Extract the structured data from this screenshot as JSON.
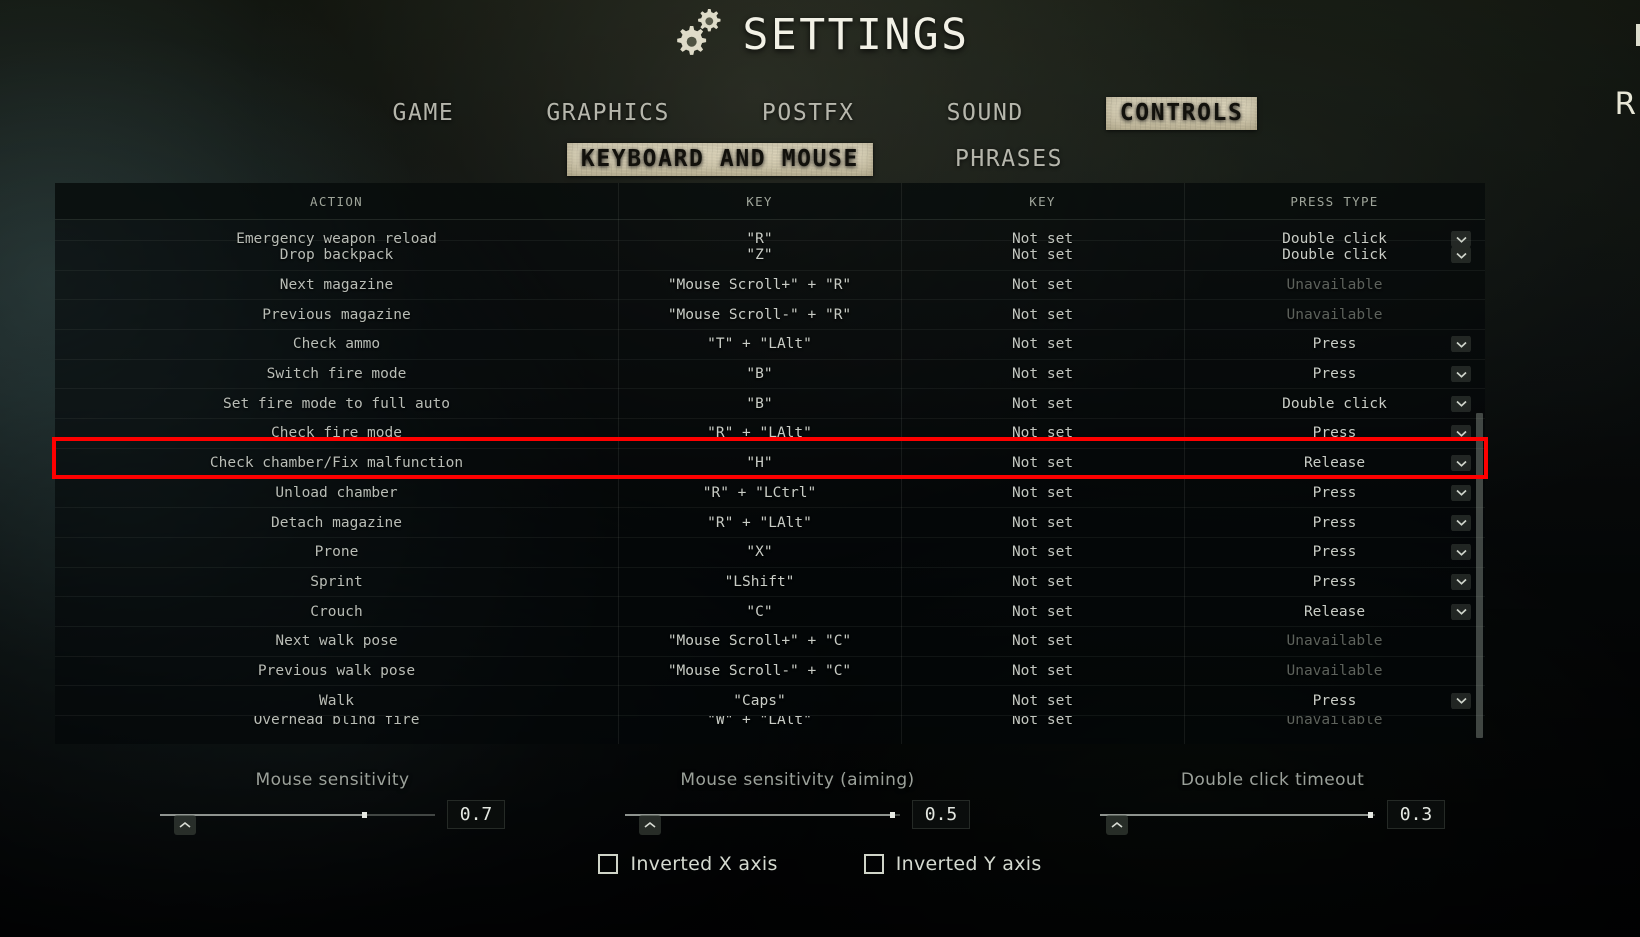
{
  "window": {
    "title": "SETTINGS",
    "gear_icon": "gears-icon",
    "edge_letter": "R"
  },
  "tabs": {
    "primary": [
      {
        "label": "GAME",
        "active": false
      },
      {
        "label": "GRAPHICS",
        "active": false
      },
      {
        "label": "POSTFX",
        "active": false
      },
      {
        "label": "SOUND",
        "active": false
      },
      {
        "label": "CONTROLS",
        "active": true
      }
    ],
    "secondary": [
      {
        "label": "KEYBOARD AND MOUSE",
        "active": true
      },
      {
        "label": "PHRASES",
        "active": false
      }
    ]
  },
  "table": {
    "headers": [
      "ACTION",
      "KEY",
      "KEY",
      "PRESS TYPE"
    ],
    "rows": [
      {
        "action": "Emergency weapon reload",
        "key1": "\"R\"",
        "key2": "Not set",
        "press": "Double click",
        "unavailable": false,
        "clip": "top"
      },
      {
        "action": "Drop backpack",
        "key1": "\"Z\"",
        "key2": "Not set",
        "press": "Double click",
        "unavailable": false
      },
      {
        "action": "Next magazine",
        "key1": "\"Mouse Scroll+\" + \"R\"",
        "key2": "Not set",
        "press": "Unavailable",
        "unavailable": true
      },
      {
        "action": "Previous magazine",
        "key1": "\"Mouse Scroll-\" + \"R\"",
        "key2": "Not set",
        "press": "Unavailable",
        "unavailable": true
      },
      {
        "action": "Check ammo",
        "key1": "\"T\" + \"LAlt\"",
        "key2": "Not set",
        "press": "Press",
        "unavailable": false
      },
      {
        "action": "Switch fire mode",
        "key1": "\"B\"",
        "key2": "Not set",
        "press": "Press",
        "unavailable": false
      },
      {
        "action": "Set fire mode to full auto",
        "key1": "\"B\"",
        "key2": "Not set",
        "press": "Double click",
        "unavailable": false
      },
      {
        "action": "Check fire mode",
        "key1": "\"R\" + \"LAlt\"",
        "key2": "Not set",
        "press": "Press",
        "unavailable": false
      },
      {
        "action": "Check chamber/Fix malfunction",
        "key1": "\"H\"",
        "key2": "Not set",
        "press": "Release",
        "unavailable": false,
        "highlighted": true
      },
      {
        "action": "Unload chamber",
        "key1": "\"R\" + \"LCtrl\"",
        "key2": "Not set",
        "press": "Press",
        "unavailable": false
      },
      {
        "action": "Detach magazine",
        "key1": "\"R\" + \"LAlt\"",
        "key2": "Not set",
        "press": "Press",
        "unavailable": false
      },
      {
        "action": "Prone",
        "key1": "\"X\"",
        "key2": "Not set",
        "press": "Press",
        "unavailable": false
      },
      {
        "action": "Sprint",
        "key1": "\"LShift\"",
        "key2": "Not set",
        "press": "Press",
        "unavailable": false
      },
      {
        "action": "Crouch",
        "key1": "\"C\"",
        "key2": "Not set",
        "press": "Release",
        "unavailable": false
      },
      {
        "action": "Next walk pose",
        "key1": "\"Mouse Scroll+\" + \"C\"",
        "key2": "Not set",
        "press": "Unavailable",
        "unavailable": true
      },
      {
        "action": "Previous walk pose",
        "key1": "\"Mouse Scroll-\" + \"C\"",
        "key2": "Not set",
        "press": "Unavailable",
        "unavailable": true
      },
      {
        "action": "Walk",
        "key1": "\"Caps\"",
        "key2": "Not set",
        "press": "Press",
        "unavailable": false
      },
      {
        "action": "Overhead blind fire",
        "key1": "\"W\" + \"LAlt\"",
        "key2": "Not set",
        "press": "Unavailable",
        "unavailable": true,
        "clip": "bottom"
      }
    ]
  },
  "sliders": [
    {
      "label": "Mouse sensitivity",
      "value": "0.7",
      "fill_pct": 74
    },
    {
      "label": "Mouse sensitivity (aiming)",
      "value": "0.5",
      "fill_pct": 97
    },
    {
      "label": "Double click timeout",
      "value": "0.3",
      "fill_pct": 98
    }
  ],
  "checkboxes": [
    {
      "label": "Inverted X axis",
      "checked": false
    },
    {
      "label": "Inverted Y axis",
      "checked": false
    }
  ],
  "colors": {
    "highlight_red": "#fe0000",
    "active_tab_bg": "#d8d0b6",
    "text": "#c9cdc6",
    "muted_text": "#5d625c"
  }
}
